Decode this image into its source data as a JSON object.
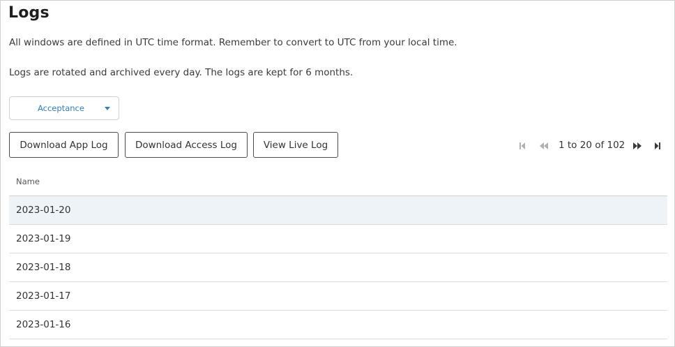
{
  "page": {
    "title": "Logs",
    "desc1": "All windows are defined in UTC time format. Remember to convert to UTC from your local time.",
    "desc2": "Logs are rotated and archived every day. The logs are kept for 6 months."
  },
  "environment": {
    "selected": "Acceptance"
  },
  "actions": {
    "download_app": "Download App Log",
    "download_access": "Download Access Log",
    "view_live": "View Live Log"
  },
  "pagination": {
    "text": "1 to 20 of 102"
  },
  "table": {
    "header": "Name",
    "rows": [
      "2023-01-20",
      "2023-01-19",
      "2023-01-18",
      "2023-01-17",
      "2023-01-16"
    ]
  },
  "colors": {
    "accent": "#2f7fc1",
    "selected_row": "#edf3f6",
    "disabled_icon": "#b0b0b0"
  },
  "icons": [
    "first-page-icon",
    "previous-page-icon",
    "next-page-icon",
    "last-page-icon",
    "caret-down-icon"
  ]
}
